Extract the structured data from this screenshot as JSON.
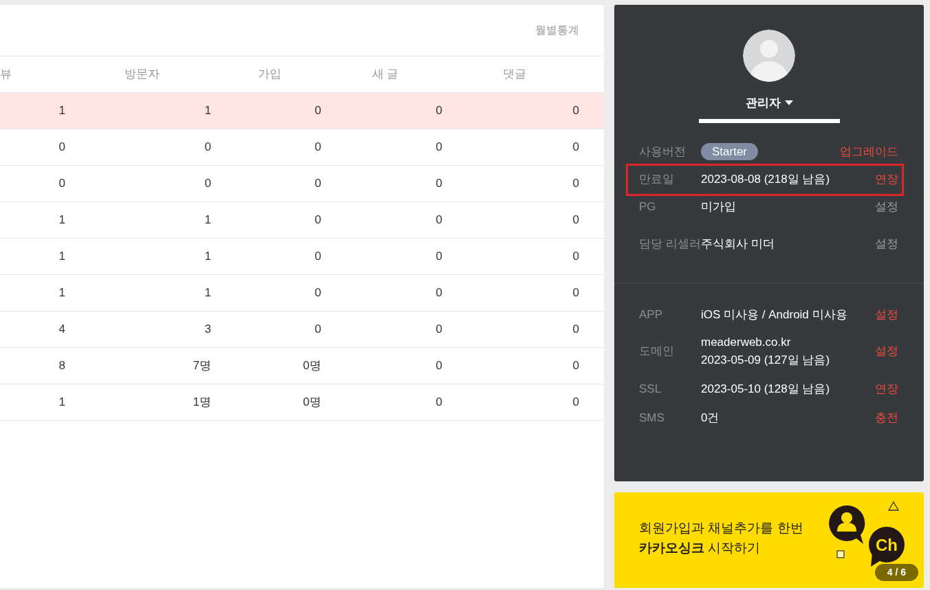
{
  "stats_card": {
    "link": "월별통계",
    "columns": [
      "뷰",
      "방문자",
      "가입",
      "새 글",
      "댓글"
    ],
    "rows": [
      {
        "highlighted": true,
        "cells": [
          "1",
          "1",
          "0",
          "0",
          "0"
        ]
      },
      {
        "highlighted": false,
        "cells": [
          "0",
          "0",
          "0",
          "0",
          "0"
        ]
      },
      {
        "highlighted": false,
        "cells": [
          "0",
          "0",
          "0",
          "0",
          "0"
        ]
      },
      {
        "highlighted": false,
        "cells": [
          "1",
          "1",
          "0",
          "0",
          "0"
        ]
      },
      {
        "highlighted": false,
        "cells": [
          "1",
          "1",
          "0",
          "0",
          "0"
        ]
      },
      {
        "highlighted": false,
        "cells": [
          "1",
          "1",
          "0",
          "0",
          "0"
        ]
      },
      {
        "highlighted": false,
        "cells": [
          "4",
          "3",
          "0",
          "0",
          "0"
        ]
      },
      {
        "highlighted": false,
        "cells": [
          "8",
          "7명",
          "0명",
          "0",
          "0"
        ]
      },
      {
        "highlighted": false,
        "cells": [
          "1",
          "1명",
          "0명",
          "0",
          "0"
        ]
      }
    ]
  },
  "profile": {
    "name": "관리자",
    "info_rows": [
      {
        "label": "사용버전",
        "kind": "badge",
        "values": [
          "Starter"
        ],
        "action": "업그레이드",
        "highlighted": false
      },
      {
        "label": "만료일",
        "kind": "text",
        "values": [
          "2023-08-08 (218일 남음)"
        ],
        "action": "연장",
        "highlighted": true
      },
      {
        "label": "PG",
        "kind": "text",
        "values": [
          "미가입"
        ],
        "action": "설정",
        "action_muted": true,
        "highlighted": false
      },
      {
        "label": "담당 리셀러",
        "kind": "text",
        "values": [
          "주식회사 미더"
        ],
        "action": "설정",
        "action_muted": true,
        "highlighted": false
      }
    ],
    "service_rows": [
      {
        "label": "APP",
        "kind": "text",
        "values": [
          "iOS 미사용 / Android 미사용"
        ],
        "action": "설정",
        "highlighted": false
      },
      {
        "label": "도메인",
        "kind": "text",
        "values": [
          "meaderweb.co.kr",
          "2023-05-09 (127일 남음)"
        ],
        "action": "설정",
        "highlighted": false
      },
      {
        "label": "SSL",
        "kind": "text",
        "values": [
          "2023-05-10 (128일 남음)"
        ],
        "action": "연장",
        "highlighted": false
      },
      {
        "label": "SMS",
        "kind": "text",
        "values": [
          "0건"
        ],
        "action": "충전",
        "highlighted": false
      }
    ]
  },
  "promo": {
    "lines": [
      "회원가입과 채널추가를 한번",
      "**카카오싱크** 시작하기"
    ],
    "badge": "Ch",
    "pager": "4 / 6"
  }
}
